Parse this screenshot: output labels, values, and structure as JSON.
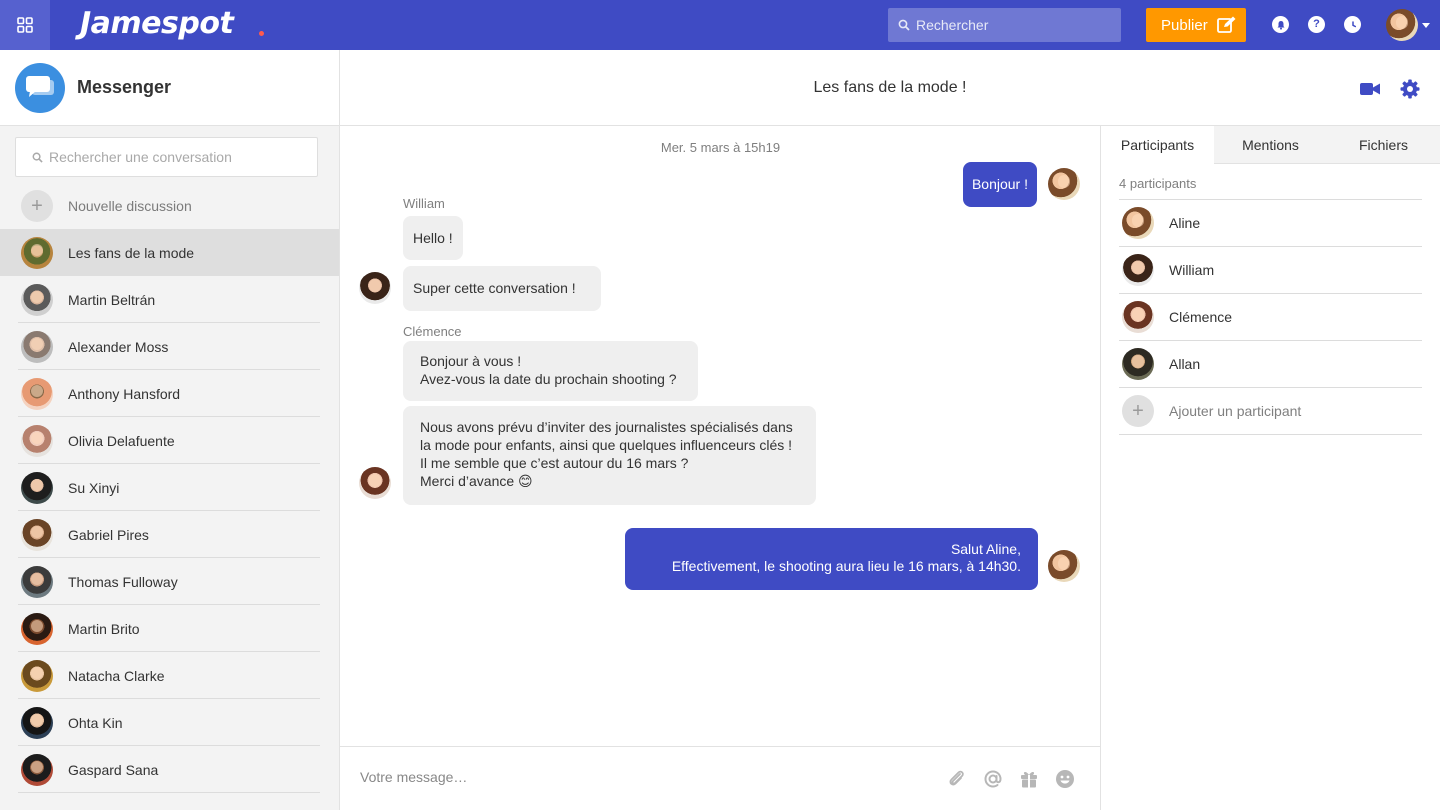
{
  "topbar": {
    "logo": "Jamespot",
    "search_placeholder": "Rechercher",
    "publish_label": "Publier",
    "icons": [
      "apps-grid-icon",
      "search-icon",
      "edit-icon",
      "notifications-icon",
      "help-icon",
      "history-icon",
      "chevron-down-icon"
    ]
  },
  "colors": {
    "brand": "#3f4bc4",
    "publish": "#ff9800",
    "messenger_logo": "#3b8fe0",
    "logo_dot": "#ff5a4d",
    "outgoing_bubble": "#3f4bc4",
    "incoming_bubble": "#efefef"
  },
  "sidebar": {
    "title": "Messenger",
    "search_placeholder": "Rechercher une conversation",
    "new_discussion": "Nouvelle discussion",
    "conversations": [
      {
        "name": "Les fans de la mode",
        "active": true
      },
      {
        "name": "Martin Beltrán"
      },
      {
        "name": "Alexander Moss"
      },
      {
        "name": "Anthony Hansford"
      },
      {
        "name": "Olivia Delafuente"
      },
      {
        "name": "Su Xinyi"
      },
      {
        "name": "Gabriel Pires"
      },
      {
        "name": "Thomas Fulloway"
      },
      {
        "name": "Martin Brito"
      },
      {
        "name": "Natacha Clarke"
      },
      {
        "name": "Ohta Kin"
      },
      {
        "name": "Gaspard Sana"
      }
    ]
  },
  "chat": {
    "title": "Les fans de la mode !",
    "header_icons": [
      "video-camera-icon",
      "settings-gear-icon"
    ],
    "date_separator": "Mer. 5 mars à 15h19",
    "messages": [
      {
        "direction": "out",
        "lines": [
          "Bonjour !"
        ]
      },
      {
        "direction": "in",
        "sender": "William",
        "lines": [
          "Hello !"
        ]
      },
      {
        "direction": "in",
        "lines": [
          "Super cette conversation !"
        ]
      },
      {
        "direction": "in",
        "sender": "Clémence",
        "lines": [
          "Bonjour à vous !",
          "Avez-vous la date du prochain shooting ?"
        ]
      },
      {
        "direction": "in",
        "lines": [
          "Nous avons prévu d’inviter des journalistes spécialisés dans",
          "la mode pour enfants, ainsi que quelques influenceurs clés !",
          "Il me semble que c’est autour du 16 mars ?",
          "Merci d’avance 😊"
        ]
      },
      {
        "direction": "out",
        "lines": [
          "Salut Aline,",
          "Effectivement, le shooting aura lieu le 16 mars, à 14h30."
        ]
      }
    ],
    "composer_placeholder": "Votre message…",
    "composer_icons": [
      "paperclip-icon",
      "mention-at-icon",
      "gift-icon",
      "emoji-icon"
    ]
  },
  "details": {
    "tabs": [
      {
        "label": "Participants",
        "active": true
      },
      {
        "label": "Mentions"
      },
      {
        "label": "Fichiers"
      }
    ],
    "participants_count": "4 participants",
    "participants": [
      "Aline",
      "William",
      "Clémence",
      "Allan"
    ],
    "add_participant": "Ajouter un participant"
  }
}
